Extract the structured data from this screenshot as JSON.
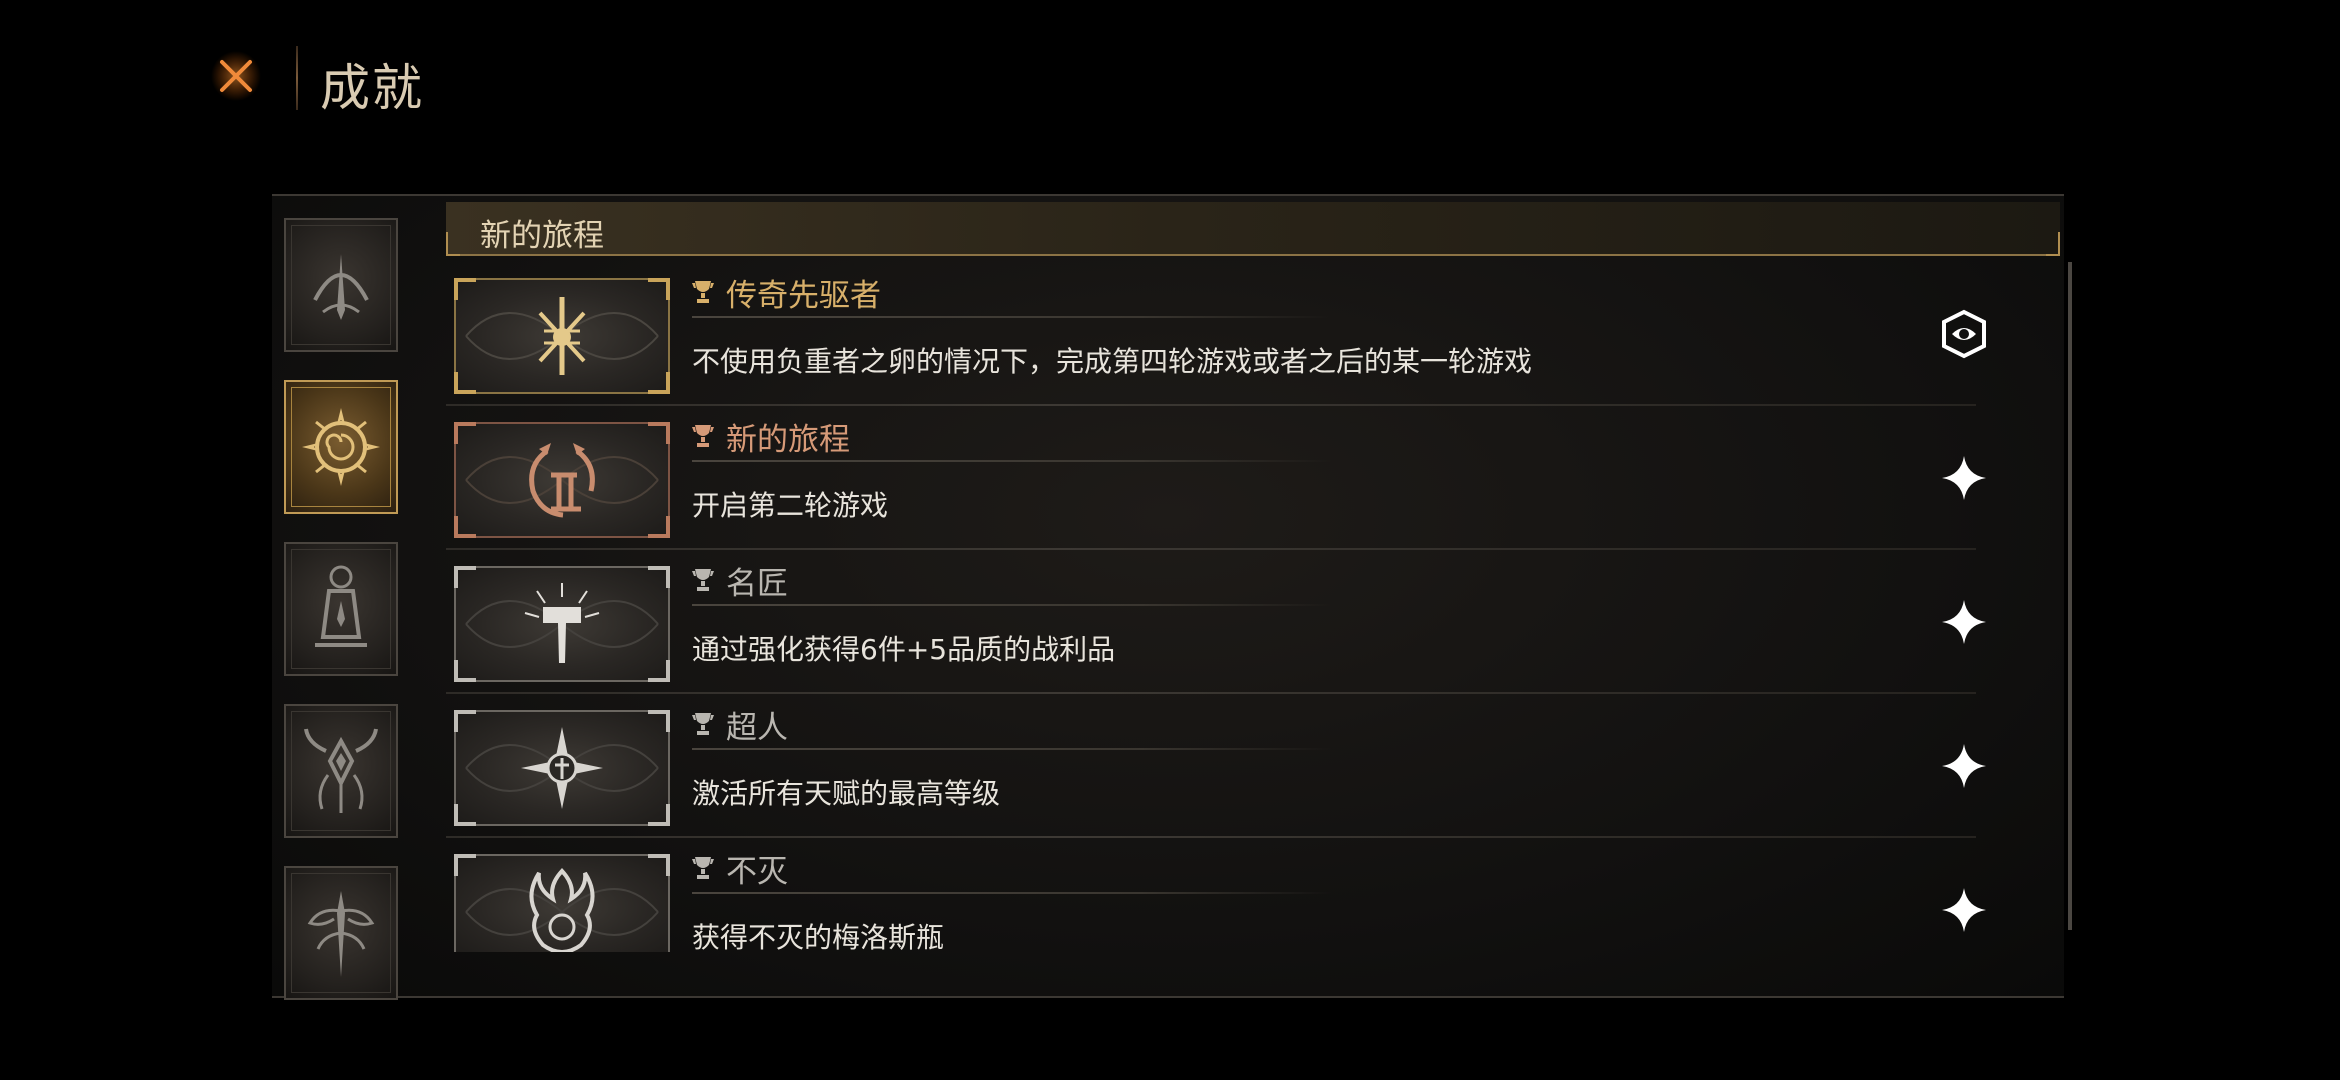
{
  "header": {
    "title": "成就",
    "close_icon": "close-x-icon"
  },
  "colors": {
    "gold": "#d8b06a",
    "bronze": "#d69a78",
    "silver": "#b9b6b0",
    "active_category": "#c09a55"
  },
  "categories": [
    {
      "icon": "arc-spire-icon",
      "active": false
    },
    {
      "icon": "sun-compass-icon",
      "active": true
    },
    {
      "icon": "lantern-icon",
      "active": false
    },
    {
      "icon": "horned-demon-icon",
      "active": false
    },
    {
      "icon": "sword-tree-icon",
      "active": false
    }
  ],
  "section": {
    "title": "新的旅程"
  },
  "achievements": [
    {
      "title": "传奇先驱者",
      "description": "不使用负重者之卵的情况下，完成第四轮游戏或者之后的某一轮游戏",
      "tier": "gold",
      "badge_icon": "crossed-sigil-icon",
      "status_icon": "completed-emblem-icon"
    },
    {
      "title": "新的旅程",
      "description": "开启第二轮游戏",
      "tier": "bronze",
      "badge_icon": "roman-two-swirl-icon",
      "status_icon": "sparkle-icon"
    },
    {
      "title": "名匠",
      "description": "通过强化获得6件+5品质的战利品",
      "tier": "silver",
      "badge_icon": "radiant-hammer-icon",
      "status_icon": "sparkle-icon"
    },
    {
      "title": "超人",
      "description": "激活所有天赋的最高等级",
      "tier": "silver",
      "badge_icon": "star-shield-icon",
      "status_icon": "sparkle-icon"
    },
    {
      "title": "不灭",
      "description": "获得不灭的梅洛斯瓶",
      "tier": "silver",
      "badge_icon": "flame-flask-icon",
      "status_icon": "sparkle-icon"
    }
  ]
}
